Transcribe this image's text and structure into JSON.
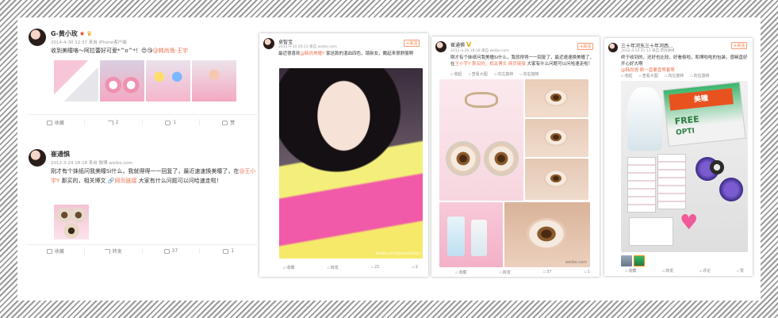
{
  "posts": [
    {
      "user": "G-黄小玫",
      "meta": "2014-4-30 12:37 来自 iPhone客户端",
      "text": "收到美瞳咯～阿拉蕾好可爱*^o^*！",
      "mention": "@韩尚逸-王宇",
      "emoji": "😍😘",
      "actions": {
        "save": "收藏",
        "forward": "2",
        "comment": "1",
        "like": "赞"
      }
    },
    {
      "user": "崔通惧",
      "meta": "2012-3-29 18:18 来自 微博 weibo.com",
      "text_a": "刚才有个妹纸问我美瞳Si什么，我就得得一一回复了，最近速速换美瞳了，在",
      "mention": "@王小宇Y",
      "text_b": " 那买的，相关博文",
      "link": "网页链接",
      "text_c": " 大家有什么问题可以问哈速走啦！",
      "actions": {
        "save": "收藏",
        "forward": "转发",
        "comment": "37",
        "like": "1"
      }
    },
    {
      "user": "卓智宝",
      "meta": "2012-9-14 20:13 来自 weibo.com",
      "follow": "+关注",
      "text_a": "最近很喜欢",
      "mention": "@韩尚美瞳Y",
      "text_b": " 家这款的混血四色，镜新女，戴起来很舒服啊",
      "watermark": "weibo.com/peachelew",
      "mini": [
        "收藏",
        "转发",
        "21",
        "2"
      ]
    },
    {
      "user": "崔通惧",
      "meta": "2012-3-29 18:18 来自 weibo.com",
      "follow": "+关注",
      "text": "刚才有个妹纸问我美瞳Si什么，我就得得一一回复了，最近速速换美瞳了，在",
      "text_2": "王小宇Y 那买的，相关博文",
      "link": "网页链接",
      "text_3": " 大家有什么问题可以问哈速走啦！",
      "tools": [
        "收起",
        "查看大图",
        "向左旋转",
        "向右旋转"
      ],
      "watermark": "weibo.com",
      "mini": [
        "收藏",
        "转发",
        "37",
        "1"
      ]
    },
    {
      "user": "三十年河东三十年河西...",
      "meta": "2012-3-14 21:15 来自 新浪微博",
      "follow": "+关注",
      "text": "终于收到的，还好也比较，好看极啦，和博啦啦的包装，感嘛直好开心好大啊",
      "text_2": "@韩尚逸 刚一直要直等着等",
      "tools": [
        "收起",
        "查看大图",
        "向左旋转",
        "向右旋转"
      ],
      "box_text": [
        "FREE",
        "OPTI",
        "美瞳"
      ],
      "mini": [
        "收藏",
        "转发",
        "评论",
        "赞"
      ]
    }
  ],
  "colors": {
    "accent": "#eb7350",
    "link": "#eb7350",
    "muted": "#999999"
  }
}
